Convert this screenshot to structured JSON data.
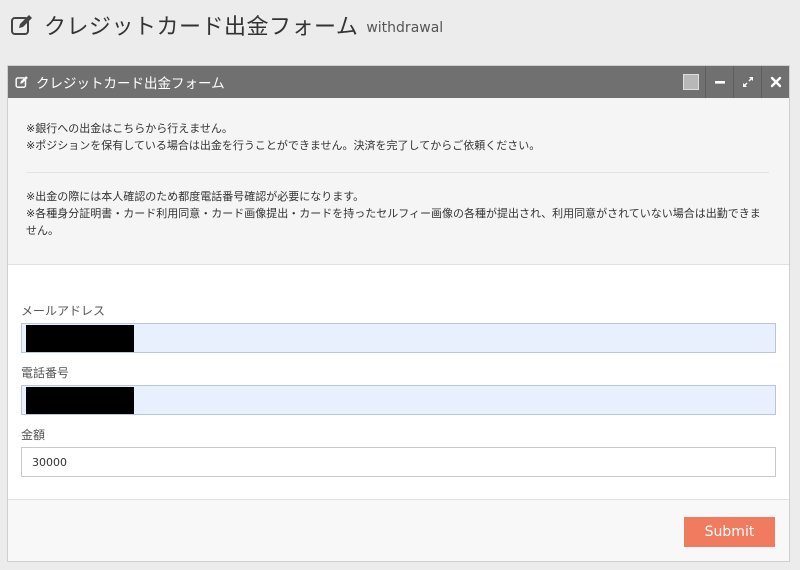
{
  "header": {
    "title": "クレジットカード出金フォーム",
    "subtitle": "withdrawal",
    "icon": "edit-icon"
  },
  "panel": {
    "title": "クレジットカード出金フォーム",
    "icon": "edit-icon",
    "controls": [
      "color-picker",
      "minimize-icon",
      "expand-icon",
      "close-icon"
    ],
    "notices": [
      "※銀行への出金はこちらから行えません。",
      "※ポジションを保有している場合は出金を行うことができません。決済を完了してからご依頼ください。",
      "※出金の際には本人確認のため都度電話番号確認が必要になります。",
      "※各種身分証明書・カード利用同意・カード画像提出・カードを持ったセルフィー画像の各種が提出され、利用同意がされていない場合は出勤できません。"
    ]
  },
  "form": {
    "email_label": "メールアドレス",
    "email_value": "",
    "phone_label": "電話番号",
    "phone_value": "",
    "amount_label": "金額",
    "amount_value": "30000",
    "submit_label": "Submit"
  },
  "colors": {
    "panel_header": "#707070",
    "autofill_bg": "#e8f0fe",
    "submit_bg": "#f07b5f"
  }
}
